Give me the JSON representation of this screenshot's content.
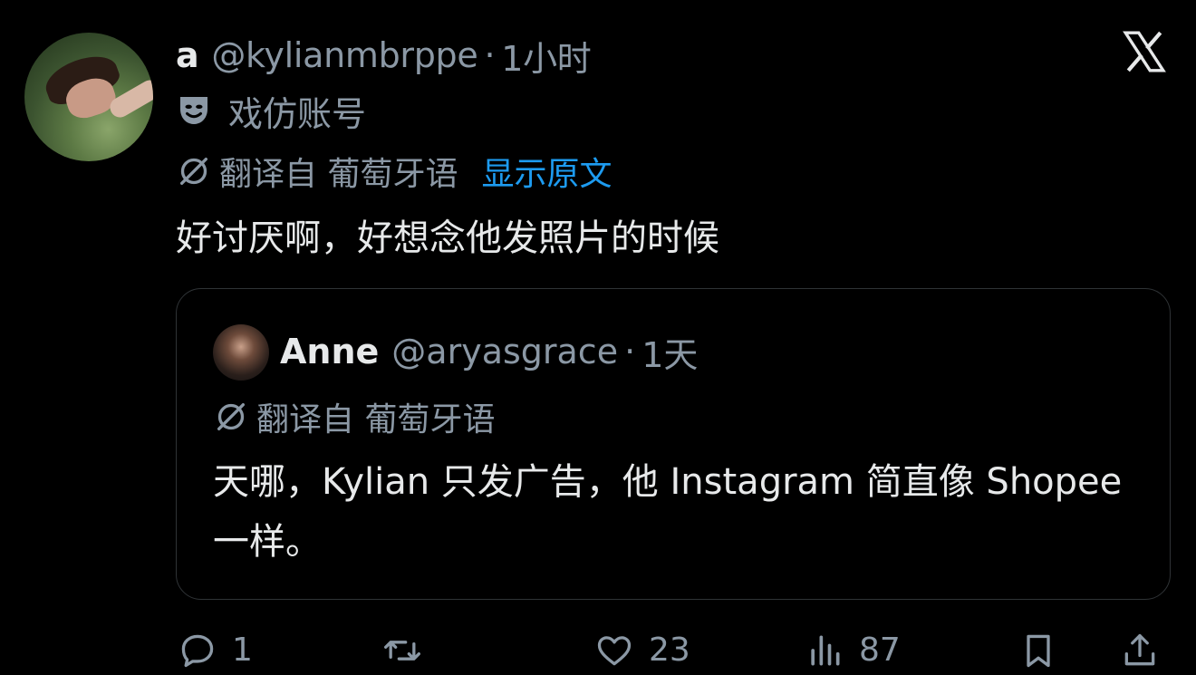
{
  "tweet": {
    "display_name": "a",
    "handle": "@kylianmbrppe",
    "separator": "·",
    "time": "1小时",
    "parody_label": "戏仿账号",
    "translated_from": "翻译自 葡萄牙语",
    "show_original": "显示原文",
    "text": "好讨厌啊，好想念他发照片的时候"
  },
  "quote": {
    "display_name": "Anne",
    "handle": "@aryasgrace",
    "separator": "·",
    "time": "1天",
    "translated_from": "翻译自 葡萄牙语",
    "text": "天哪，Kylian 只发广告，他 Instagram 简直像 Shopee 一样。"
  },
  "actions": {
    "replies": "1",
    "likes": "23",
    "views": "87"
  },
  "icons": {
    "logo": "x-logo-icon",
    "parody": "theater-mask-icon",
    "translate": "translate-slash-icon",
    "reply": "reply-icon",
    "retweet": "retweet-icon",
    "like": "heart-icon",
    "views": "views-chart-icon",
    "bookmark": "bookmark-icon",
    "share": "share-icon"
  },
  "colors": {
    "background": "#000000",
    "text": "#e7e9ea",
    "muted": "#8b98a5",
    "link": "#1d9bf0",
    "border": "#2f3336"
  }
}
